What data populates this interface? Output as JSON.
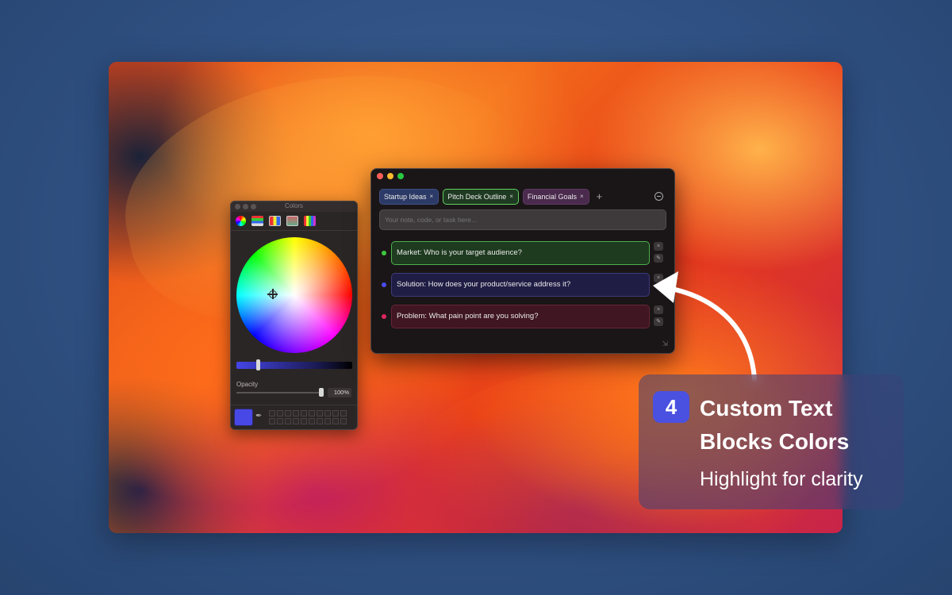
{
  "colors_panel": {
    "title": "Colors",
    "opacity_label": "Opacity",
    "opacity_value": "100%",
    "opacity_fraction": 1.0,
    "selected_color": "#4848e6"
  },
  "notes_window": {
    "tabs": [
      {
        "label": "Startup Ideas",
        "close": "×",
        "bg": "#2b3a66",
        "border": "#3e4f85"
      },
      {
        "label": "Pitch Deck Outline",
        "close": "×",
        "bg": "#1f3a22",
        "border": "#5fd05f"
      },
      {
        "label": "Financial Goals",
        "close": "×",
        "bg": "#4a2a4d",
        "border": "#5e3a62"
      }
    ],
    "add_tab": "+",
    "input_placeholder": "Your note, code, or task here...",
    "blocks": [
      {
        "text": "Market: Who is your target audience?",
        "dot": "#3ec93e",
        "bg": "#1e3a1f",
        "border": "#4cb04c"
      },
      {
        "text": "Solution: How does your product/service address it?",
        "dot": "#4b4bf0",
        "bg": "#201d45",
        "border": "#3c3a78"
      },
      {
        "text": "Problem: What pain point are you solving?",
        "dot": "#e0265e",
        "bg": "#3f1622",
        "border": "#6a2436"
      }
    ],
    "block_buttons": {
      "close": "×",
      "edit": "✎"
    }
  },
  "feature": {
    "number": "4",
    "title": "Custom Text Blocks Colors",
    "subtitle": "Highlight for clarity"
  }
}
